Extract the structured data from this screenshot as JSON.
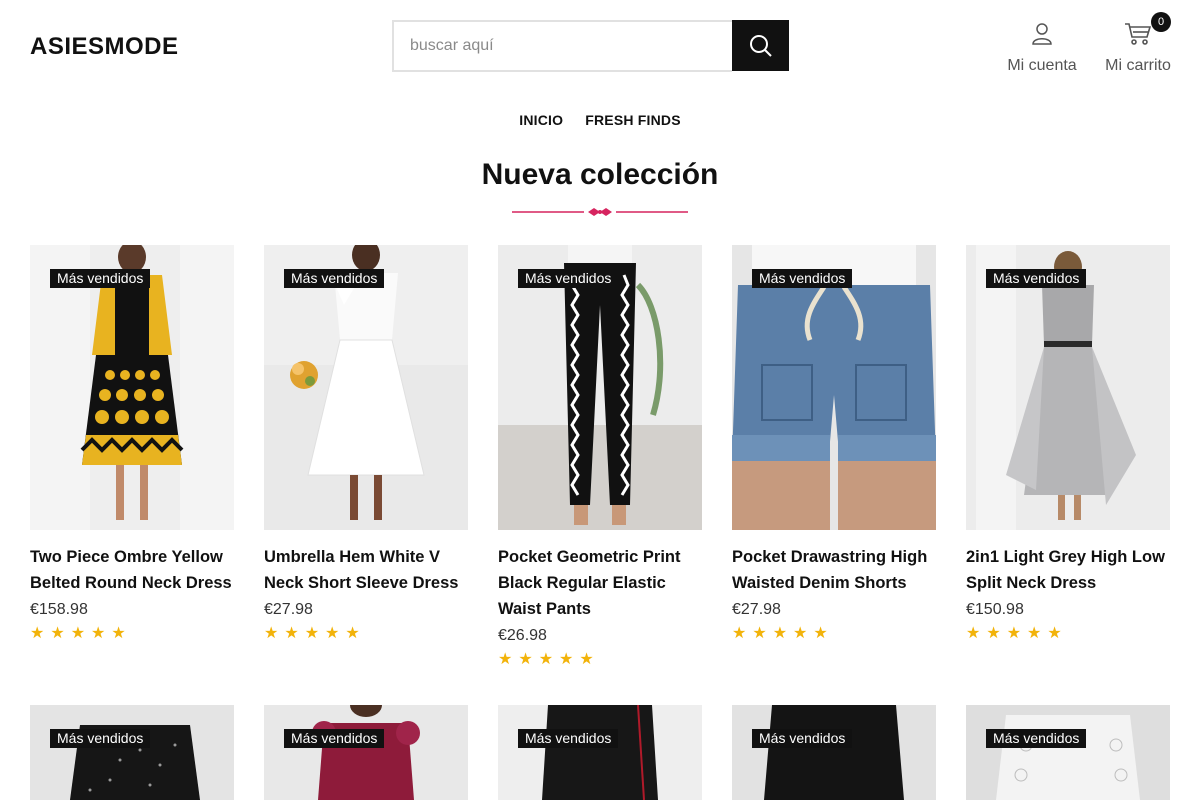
{
  "header": {
    "logo": "ASIESMODE",
    "search_placeholder": "buscar aquí",
    "account_label": "Mi cuenta",
    "cart_label": "Mi carrito",
    "cart_count": "0"
  },
  "nav": {
    "items": [
      "INICIO",
      "FRESH FINDS"
    ]
  },
  "section": {
    "title": "Nueva colección"
  },
  "badge_label": "Más vendidos",
  "products": [
    {
      "title": "Two Piece Ombre Yellow Belted Round Neck Dress",
      "price": "€158.98",
      "rating": 5
    },
    {
      "title": "Umbrella Hem White V Neck Short Sleeve Dress",
      "price": "€27.98",
      "rating": 5
    },
    {
      "title": "Pocket Geometric Print Black Regular Elastic Waist Pants",
      "price": "€26.98",
      "rating": 5
    },
    {
      "title": "Pocket Drawastring High Waisted Denim Shorts",
      "price": "€27.98",
      "rating": 5
    },
    {
      "title": "2in1 Light Grey High Low Split Neck Dress",
      "price": "€150.98",
      "rating": 5
    }
  ],
  "products_row2_badges": [
    "Más vendidos",
    "Más vendidos",
    "Más vendidos",
    "Más vendidos",
    "Más vendidos"
  ],
  "colors": {
    "star": "#f2b30a",
    "badge_bg": "#111111",
    "divider": "#d6245f"
  }
}
